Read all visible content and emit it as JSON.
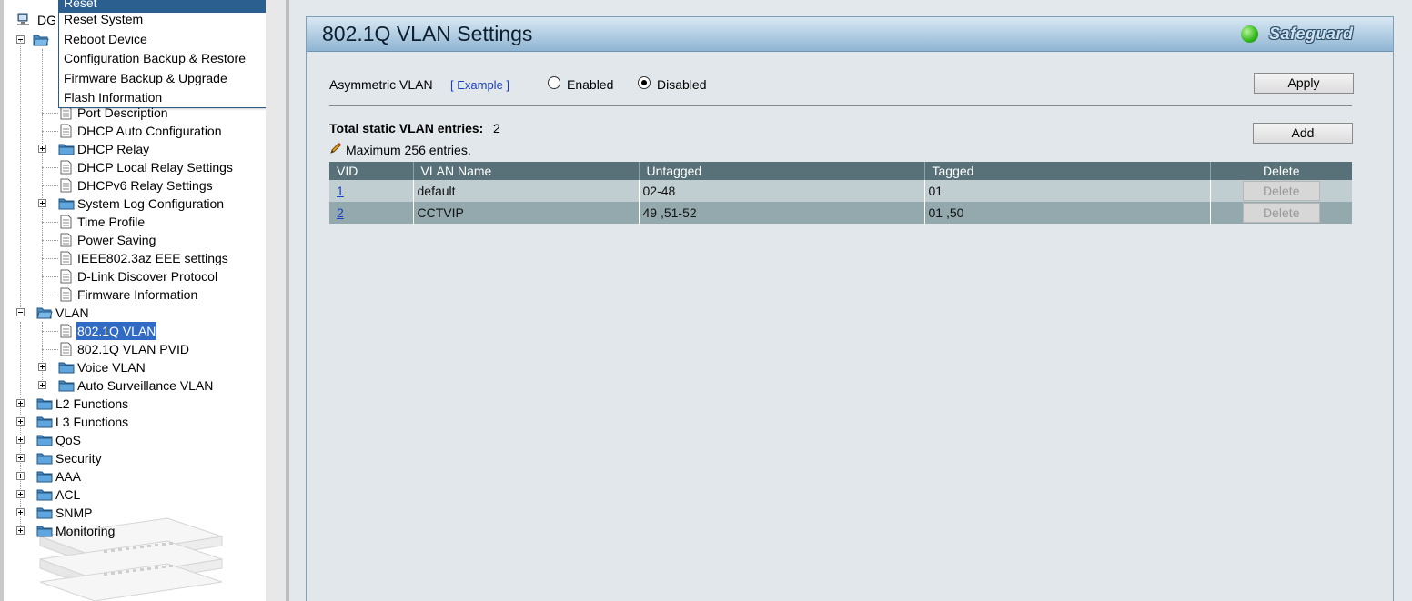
{
  "tree": {
    "root_label": "DG",
    "items": [
      {
        "label": "Port Description"
      },
      {
        "label": "DHCP Auto Configuration"
      },
      {
        "label": "DHCP Relay"
      },
      {
        "label": "DHCP Local Relay Settings"
      },
      {
        "label": "DHCPv6 Relay Settings"
      },
      {
        "label": "System Log Configuration"
      },
      {
        "label": "Time Profile"
      },
      {
        "label": "Power Saving"
      },
      {
        "label": "IEEE802.3az EEE settings"
      },
      {
        "label": "D-Link Discover Protocol"
      },
      {
        "label": "Firmware Information"
      },
      {
        "label": "VLAN"
      },
      {
        "label": "802.1Q VLAN"
      },
      {
        "label": "802.1Q VLAN PVID"
      },
      {
        "label": "Voice VLAN"
      },
      {
        "label": "Auto Surveillance VLAN"
      },
      {
        "label": "L2 Functions"
      },
      {
        "label": "L3 Functions"
      },
      {
        "label": "QoS"
      },
      {
        "label": "Security"
      },
      {
        "label": "AAA"
      },
      {
        "label": "ACL"
      },
      {
        "label": "SNMP"
      },
      {
        "label": "Monitoring"
      }
    ]
  },
  "tools_menu": {
    "items": [
      {
        "label": "Reset"
      },
      {
        "label": "Reset System"
      },
      {
        "label": "Reboot Device"
      },
      {
        "label": "Configuration Backup & Restore"
      },
      {
        "label": "Firmware Backup & Upgrade"
      },
      {
        "label": "Flash Information"
      }
    ]
  },
  "panel": {
    "title": "802.1Q VLAN Settings",
    "safeguard_label": "Safeguard"
  },
  "asymmetric": {
    "label": "Asymmetric VLAN",
    "example_link": "[ Example ]",
    "enabled_label": "Enabled",
    "disabled_label": "Disabled",
    "selected": "Disabled",
    "apply_label": "Apply"
  },
  "entries": {
    "total_label": "Total static VLAN entries:",
    "total_value": "2",
    "max_note": "Maximum 256 entries.",
    "add_label": "Add"
  },
  "table": {
    "headers": [
      "VID",
      "VLAN Name",
      "Untagged",
      "Tagged",
      "Delete"
    ],
    "rows": [
      {
        "vid": "1",
        "name": "default",
        "untagged": "02-48",
        "tagged": "01",
        "delete": "Delete"
      },
      {
        "vid": "2",
        "name": "CCTVIP",
        "untagged": "49 ,51-52",
        "tagged": "01 ,50",
        "delete": "Delete"
      }
    ]
  },
  "colors": {
    "header_row": "#587078",
    "row_odd": "#c0cdd1",
    "row_even": "#93a9ae",
    "selected_tree": "#316ac5",
    "menu_highlight": "#2b5f8f"
  }
}
